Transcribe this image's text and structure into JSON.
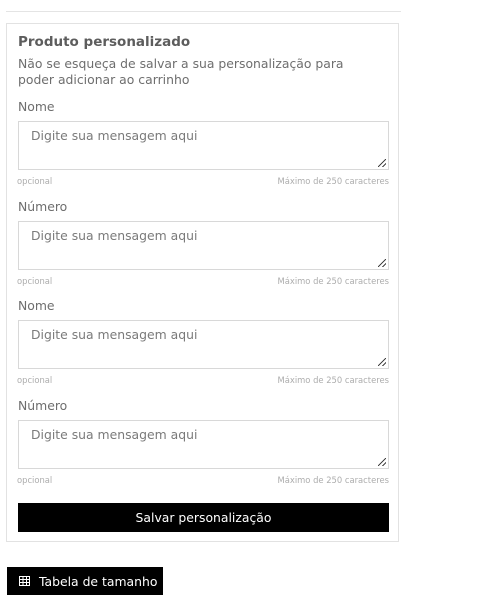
{
  "customization": {
    "title": "Produto personalizado",
    "description": "Não se esqueça de salvar a sua personalização para poder adicionar ao carrinho",
    "fields": [
      {
        "label": "Nome",
        "placeholder": "Digite sua mensagem aqui",
        "hint": "opcional",
        "limit": "Máximo de 250 caracteres"
      },
      {
        "label": "Número",
        "placeholder": "Digite sua mensagem aqui",
        "hint": "opcional",
        "limit": "Máximo de 250 caracteres"
      },
      {
        "label": "Nome",
        "placeholder": "Digite sua mensagem aqui",
        "hint": "opcional",
        "limit": "Máximo de 250 caracteres"
      },
      {
        "label": "Número",
        "placeholder": "Digite sua mensagem aqui",
        "hint": "opcional",
        "limit": "Máximo de 250 caracteres"
      }
    ],
    "save_label": "Salvar personalização"
  },
  "size_table": {
    "label": "Tabela de tamanho",
    "icon": "table-icon"
  }
}
